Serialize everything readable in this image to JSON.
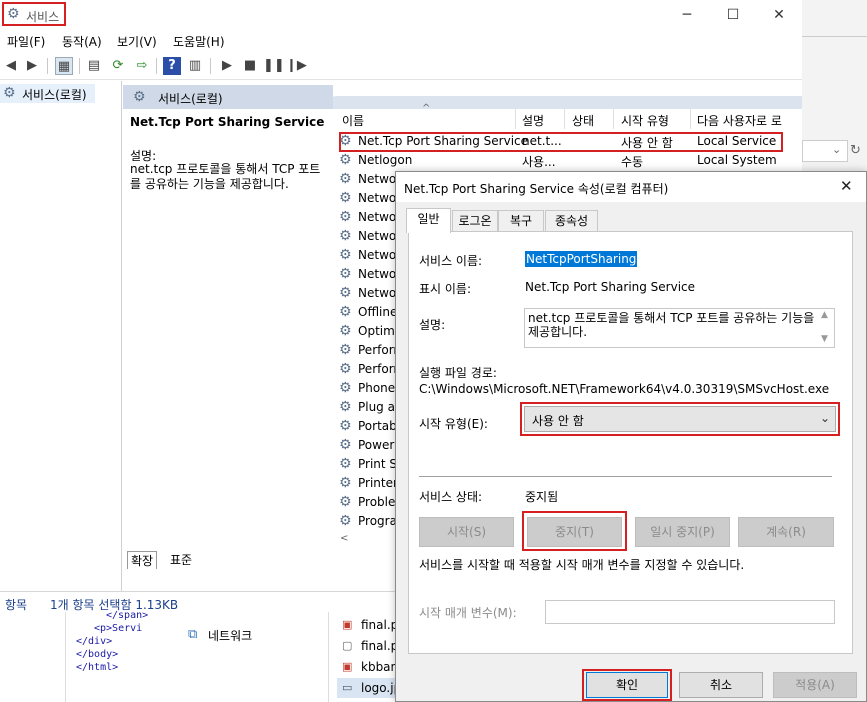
{
  "window": {
    "title": "서비스",
    "controls": {
      "minimize": "─",
      "maximize": "☐",
      "close": "✕"
    }
  },
  "menu": [
    "파일(F)",
    "동작(A)",
    "보기(V)",
    "도움말(H)"
  ],
  "tree": {
    "root": "서비스(로컬)"
  },
  "center": {
    "header": "서비스(로컬)",
    "selected_title": "Net.Tcp Port Sharing Service",
    "desc_label": "설명:",
    "desc_text": "net.tcp 프로토콜을 통해서 TCP 포트를 공유하는 기능을 제공합니다."
  },
  "list": {
    "columns": [
      "이름",
      "설명",
      "상태",
      "시작 유형",
      "다음 사용자로 로"
    ],
    "rows": [
      {
        "name": "Net.Tcp Port Sharing Service",
        "desc": "net.t...",
        "status": "",
        "start": "사용 안 함",
        "logon": "Local Service"
      },
      {
        "name": "Netlogon",
        "desc": "사용...",
        "status": "",
        "start": "수동",
        "logon": "Local System"
      },
      {
        "name": "Netwo"
      },
      {
        "name": "Netwo"
      },
      {
        "name": "Netwo"
      },
      {
        "name": "Netwo"
      },
      {
        "name": "Netwo"
      },
      {
        "name": "Netwo"
      },
      {
        "name": "Netwo"
      },
      {
        "name": "Offline"
      },
      {
        "name": "Optimi"
      },
      {
        "name": "Perforr"
      },
      {
        "name": "Perforr"
      },
      {
        "name": "Phone"
      },
      {
        "name": "Plug ar"
      },
      {
        "name": "Portab"
      },
      {
        "name": "Power"
      },
      {
        "name": "Print S"
      },
      {
        "name": "Printer"
      },
      {
        "name": "Probler"
      },
      {
        "name": "Progra"
      }
    ]
  },
  "tabs_bottom": [
    "확장",
    "표준"
  ],
  "status": {
    "left": "항목",
    "text": "1개 항목 선택함 1.13KB"
  },
  "explorer": {
    "code_lines": [
      "</span>",
      "<p>Servi",
      "</div>",
      "</body>",
      "</html>"
    ],
    "network": "네트워크",
    "files": [
      "final.p",
      "final.p",
      "kbban",
      "logo.jp"
    ]
  },
  "dialog": {
    "title": "Net.Tcp Port Sharing Service 속성(로컬 컴퓨터)",
    "close": "✕",
    "tabs": [
      "일반",
      "로그온",
      "복구",
      "종속성"
    ],
    "service_name_label": "서비스 이름:",
    "service_name": "NetTcpPortSharing",
    "display_name_label": "표시 이름:",
    "display_name": "Net.Tcp Port Sharing Service",
    "desc_label": "설명:",
    "desc_text": "net.tcp 프로토콜을 통해서 TCP 포트를 공유하는 기능을 제공합니다.",
    "exe_label": "실행 파일 경로:",
    "exe_path": "C:\\Windows\\Microsoft.NET\\Framework64\\v4.0.30319\\SMSvcHost.exe",
    "startup_label": "시작 유형(E):",
    "startup_value": "사용 안 함",
    "status_label": "서비스 상태:",
    "status_value": "중지됨",
    "buttons": {
      "start": "시작(S)",
      "stop": "중지(T)",
      "pause": "일시 중지(P)",
      "resume": "계속(R)"
    },
    "hint": "서비스를 시작할 때 적용할 시작 매개 변수를 지정할 수 있습니다.",
    "param_label": "시작 매개 변수(M):",
    "param_value": "",
    "ok": "확인",
    "cancel": "취소",
    "apply": "적용(A)"
  },
  "colors": {
    "highlight": "#d42020",
    "selection": "#0078d7"
  }
}
